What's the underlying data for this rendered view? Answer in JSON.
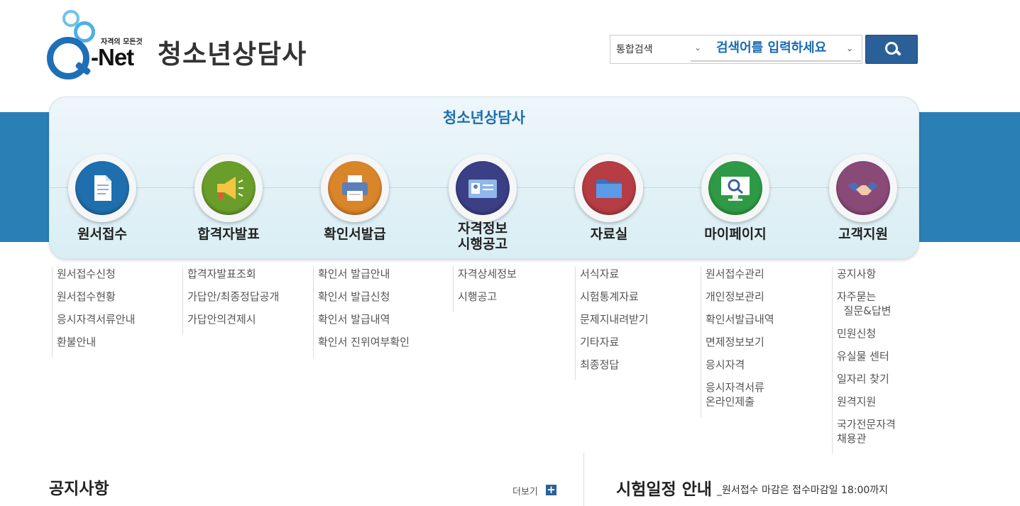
{
  "header": {
    "logo_tagline": "자격의 모든것",
    "logo_text": "-Net",
    "site_title": "청소년상담사"
  },
  "search": {
    "category": "통합검색",
    "placeholder": "검색어를 입력하세요"
  },
  "nav": {
    "title": "청소년상담사",
    "items": [
      {
        "label": "원서접수",
        "icon": "document-icon",
        "color": "#1f6fae"
      },
      {
        "label": "합격자발표",
        "icon": "megaphone-icon",
        "color": "#6a9e2a"
      },
      {
        "label": "확인서발급",
        "icon": "printer-icon",
        "color": "#d9852a"
      },
      {
        "label_line1": "자격정보",
        "label_line2": "시행공고",
        "icon": "id-card-icon",
        "color": "#3b3f85"
      },
      {
        "label": "자료실",
        "icon": "folder-icon",
        "color": "#b53d43"
      },
      {
        "label": "마이페이지",
        "icon": "monitor-search-icon",
        "color": "#2f9a45"
      },
      {
        "label": "고객지원",
        "icon": "handshake-icon",
        "color": "#8a4a78"
      }
    ]
  },
  "submenus": [
    [
      "원서접수신청",
      "원서접수현황",
      "응시자격서류안내",
      "환불안내"
    ],
    [
      "합격자발표조회",
      "가답안/최종정답공개",
      "가답안의견제시"
    ],
    [
      "확인서 발급안내",
      "확인서 발급신청",
      "확인서 발급내역",
      "확인서 진위여부확인"
    ],
    [
      "자격상세정보",
      "시행공고"
    ],
    [
      "서식자료",
      "시험통계자료",
      "문제지내려받기",
      "기타자료",
      "최종정답"
    ],
    [
      "원서접수관리",
      "개인정보관리",
      "확인서발급내역",
      "면제정보보기",
      "응시자격",
      "응시자격서류\n온라인제출"
    ],
    [
      "공지사항",
      "자주묻는\n  질문&답변",
      "민원신청",
      "유실물 센터",
      "일자리 찾기",
      "원격지원",
      "국가전문자격\n채용관"
    ]
  ],
  "notice": {
    "title": "공지사항",
    "more": "더보기"
  },
  "schedule": {
    "title": "시험일정 안내",
    "subtitle": "_원서접수 마감은 접수마감일 18:00까지"
  }
}
